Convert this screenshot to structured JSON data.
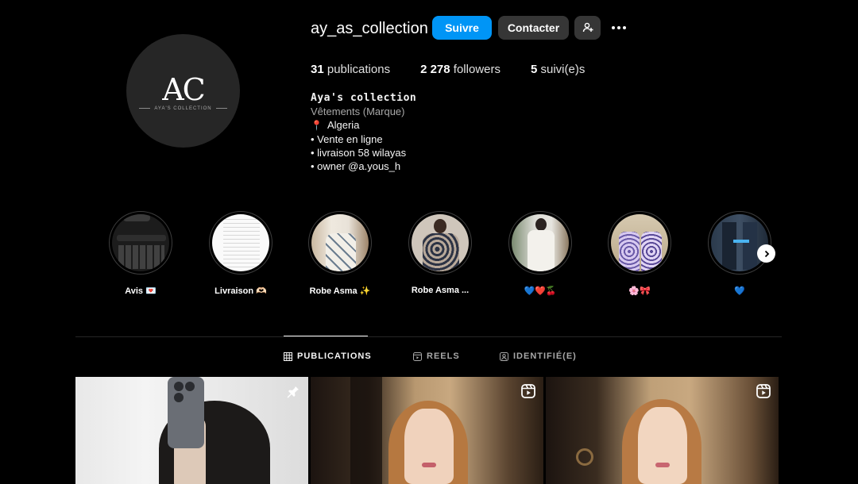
{
  "profile": {
    "username": "ay_as_collection",
    "avatar_monogram": "AC",
    "avatar_subtitle": "AYA'S COLLECTION",
    "follow_label": "Suivre",
    "contact_label": "Contacter",
    "stats": {
      "posts_count": "31",
      "posts_label": "publications",
      "followers_count": "2 278",
      "followers_label": "followers",
      "following_count": "5",
      "following_label": "suivi(e)s"
    },
    "bio": {
      "name": "Aya's collection",
      "category": "Vêtements (Marque)",
      "line_location": "Algeria",
      "line_1": "• Vente en ligne",
      "line_2": "• livraison 58 wilayas",
      "line_3": "• owner @a.yous_h"
    }
  },
  "highlights": [
    {
      "label": "Avis 💌"
    },
    {
      "label": "Livraison 🫶🏻"
    },
    {
      "label": "Robe Asma ✨"
    },
    {
      "label": "Robe Asma ..."
    },
    {
      "label": "💙❤️🍒"
    },
    {
      "label": "🌸🎀"
    },
    {
      "label": "💙"
    }
  ],
  "tabs": [
    {
      "label": "PUBLICATIONS",
      "active": true
    },
    {
      "label": "REELS",
      "active": false
    },
    {
      "label": "IDENTIFIÉ(E)",
      "active": false
    }
  ],
  "colors": {
    "accent": "#0095f6",
    "button_secondary": "#363636",
    "background": "#000000",
    "text_secondary": "#a8a8a8"
  },
  "icons": {
    "pin": "pin-icon",
    "reel": "reel-icon",
    "location": "location-pin-icon",
    "add_user": "add-user-icon",
    "more": "more-horizontal-icon",
    "next": "chevron-right-icon"
  }
}
